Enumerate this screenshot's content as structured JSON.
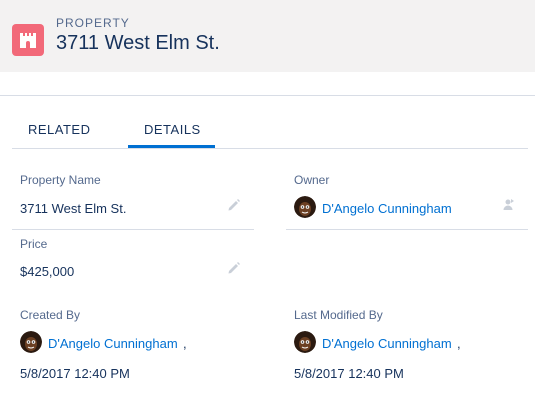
{
  "header": {
    "object_type": "PROPERTY",
    "title": "3711 West Elm St."
  },
  "tabs": [
    {
      "label": "RELATED",
      "active": false
    },
    {
      "label": "DETAILS",
      "active": true
    }
  ],
  "fields": {
    "property_name": {
      "label": "Property Name",
      "value": "3711 West Elm St."
    },
    "owner": {
      "label": "Owner",
      "value": "D'Angelo Cunningham"
    },
    "price": {
      "label": "Price",
      "value": "$425,000"
    },
    "created_by": {
      "label": "Created By",
      "user": "D'Angelo Cunningham",
      "separator": ",",
      "date": "5/8/2017 12:40 PM"
    },
    "last_modified_by": {
      "label": "Last Modified By",
      "user": "D'Angelo Cunningham",
      "separator": ",",
      "date": "5/8/2017 12:40 PM"
    }
  },
  "colors": {
    "accent": "#0070d2",
    "object_icon": "#f26979",
    "header_bg": "#f3f2f2",
    "label_text": "#54698d",
    "body_text": "#16325c"
  },
  "icons": {
    "object": "castle-icon",
    "edit": "pencil-icon",
    "change_owner": "change-owner-icon",
    "avatar": "user-avatar"
  }
}
